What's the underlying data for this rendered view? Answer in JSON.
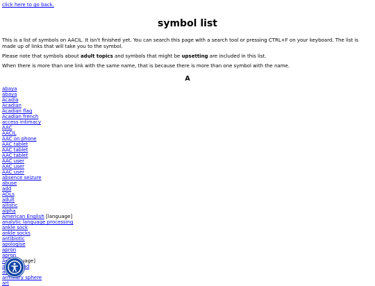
{
  "back_link": "click here to go back.",
  "title": "symbol list",
  "intro": "This is a list of symbols on AACIL. It isn't finished yet. You can search this page with a search tool or pressing CTRL+F on your keyboard. The list is made up of links that will take you to the symbol.",
  "notice": {
    "before": "Please note that symbols about ",
    "bold1": "adult topics",
    "middle": " and symbols that might be ",
    "bold2": "upsetting",
    "after": " are included in this list."
  },
  "duplicate_note": "When there is more than one link with the same name, that is because there is more than one symbol with the name.",
  "section_letter": "A",
  "symbols": [
    {
      "label": "abaya",
      "note": ""
    },
    {
      "label": "abaya",
      "note": ""
    },
    {
      "label": "Acadia",
      "note": ""
    },
    {
      "label": "Acadian",
      "note": ""
    },
    {
      "label": "Acadian flag",
      "note": ""
    },
    {
      "label": "Acadian french",
      "note": ""
    },
    {
      "label": "access intimacy",
      "note": ""
    },
    {
      "label": "AAC",
      "note": ""
    },
    {
      "label": "AACIL",
      "note": ""
    },
    {
      "label": "AAC on phone",
      "note": ""
    },
    {
      "label": "AAC tablet",
      "note": ""
    },
    {
      "label": "AAC tablet",
      "note": ""
    },
    {
      "label": "AAC tablet",
      "note": ""
    },
    {
      "label": "AAC user",
      "note": ""
    },
    {
      "label": "AAC user",
      "note": ""
    },
    {
      "label": "AAC user",
      "note": ""
    },
    {
      "label": "absence seizure",
      "note": ""
    },
    {
      "label": "abuse",
      "note": ""
    },
    {
      "label": "add",
      "note": ""
    },
    {
      "label": "ADLs",
      "note": ""
    },
    {
      "label": "adult",
      "note": ""
    },
    {
      "label": "allistic",
      "note": ""
    },
    {
      "label": "alpha",
      "note": ""
    },
    {
      "label": "American English",
      "note": "[language]"
    },
    {
      "label": "analytic language processing",
      "note": ""
    },
    {
      "label": "ankle sock",
      "note": ""
    },
    {
      "label": "ankle socks",
      "note": ""
    },
    {
      "label": "antibiotic",
      "note": ""
    },
    {
      "label": "apologise",
      "note": ""
    },
    {
      "label": "apron",
      "note": ""
    },
    {
      "label": "apron",
      "note": ""
    },
    {
      "label": "Ar",
      "note": "[language]"
    },
    {
      "label": "a…nce pad",
      "note": ""
    },
    {
      "label": "a…s",
      "note": ""
    },
    {
      "label": "armillary sphere",
      "note": ""
    },
    {
      "label": "art",
      "note": ""
    }
  ],
  "accessibility_widget": {
    "icon": "accessibility-person-icon",
    "color": "#1345a6"
  }
}
